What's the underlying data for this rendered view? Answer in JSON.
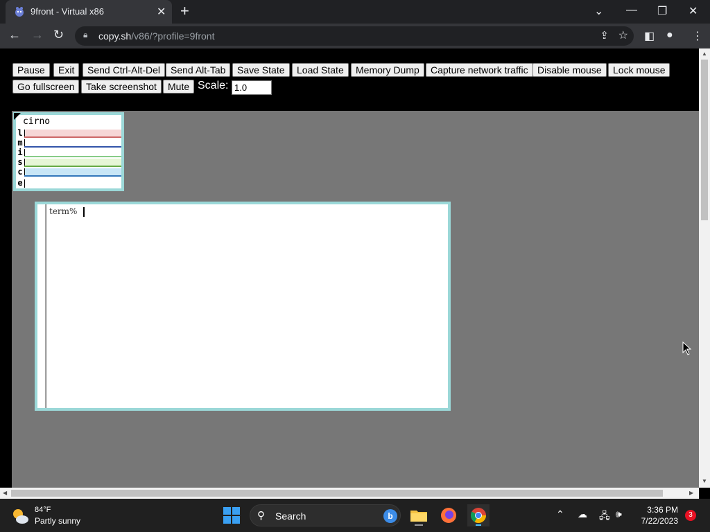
{
  "browser": {
    "tab_title": "9front - Virtual x86",
    "tab_close": "✕",
    "new_tab": "+",
    "url_host": "copy.sh",
    "url_path": "/v86/?profile=9front"
  },
  "controls": {
    "buttons": [
      "Pause",
      "Exit",
      "Send Ctrl-Alt-Del",
      "Send Alt-Tab",
      "Save State",
      "Load State",
      "Memory Dump",
      "Capture network traffic",
      "Disable mouse",
      "Lock mouse",
      "Go fullscreen",
      "Take screenshot",
      "Mute"
    ],
    "scale_label": "Scale:",
    "scale_value": "1.0"
  },
  "emulator": {
    "stats_title": "cirno",
    "stat_rows": [
      {
        "label": "l",
        "color": "#f6d6d6",
        "line": "#cc6666"
      },
      {
        "label": "m",
        "color": "#ffffff",
        "line": "#3355aa"
      },
      {
        "label": "i",
        "color": "#ffffff",
        "line": "#88cc88"
      },
      {
        "label": "s",
        "color": "#e6f6d6",
        "line": "#66aa44"
      },
      {
        "label": "c",
        "color": "#c8e6f6",
        "line": "#3377bb"
      },
      {
        "label": "e",
        "color": "#ffffff",
        "line": "#ffffff"
      }
    ],
    "prompt": "term%"
  },
  "taskbar": {
    "temperature": "84°F",
    "weather": "Partly sunny",
    "search_label": "Search",
    "time": "3:36 PM",
    "date": "7/22/2023",
    "notification_count": "3"
  }
}
